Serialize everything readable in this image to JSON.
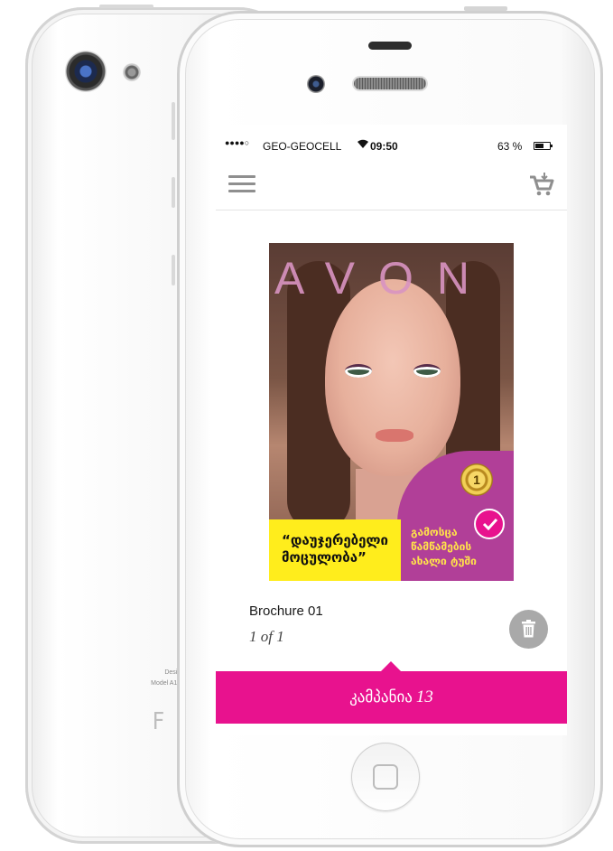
{
  "status_bar": {
    "signal": "●●●●○",
    "carrier": "GEO-GEOCELL",
    "time": "09:50",
    "battery_percent": "63 %",
    "battery_level": 0.63
  },
  "back_phone": {
    "designed_text": "Designe",
    "model_text": "Model A1387",
    "logo_text": "F"
  },
  "toolbar": {
    "menu_icon": "hamburger-icon",
    "cart_icon": "shopping-cart-icon"
  },
  "brochure": {
    "cover_brand": "AVON",
    "cover_medal": "1",
    "cover_yellow_text": "“დაუჯერებელი მოცულობა”",
    "cover_purple_text": "გამოსცა წამწამების ახალი ტუში",
    "name": "Brochure 01",
    "page_count": "1 of 1",
    "selected": true
  },
  "campaign": {
    "label": "კამპანია",
    "number": "13"
  },
  "colors": {
    "accent": "#e8128e",
    "cover_yellow": "#ffed1c",
    "cover_purple": "#b13f98",
    "delete_grey": "#a9a9a9"
  }
}
